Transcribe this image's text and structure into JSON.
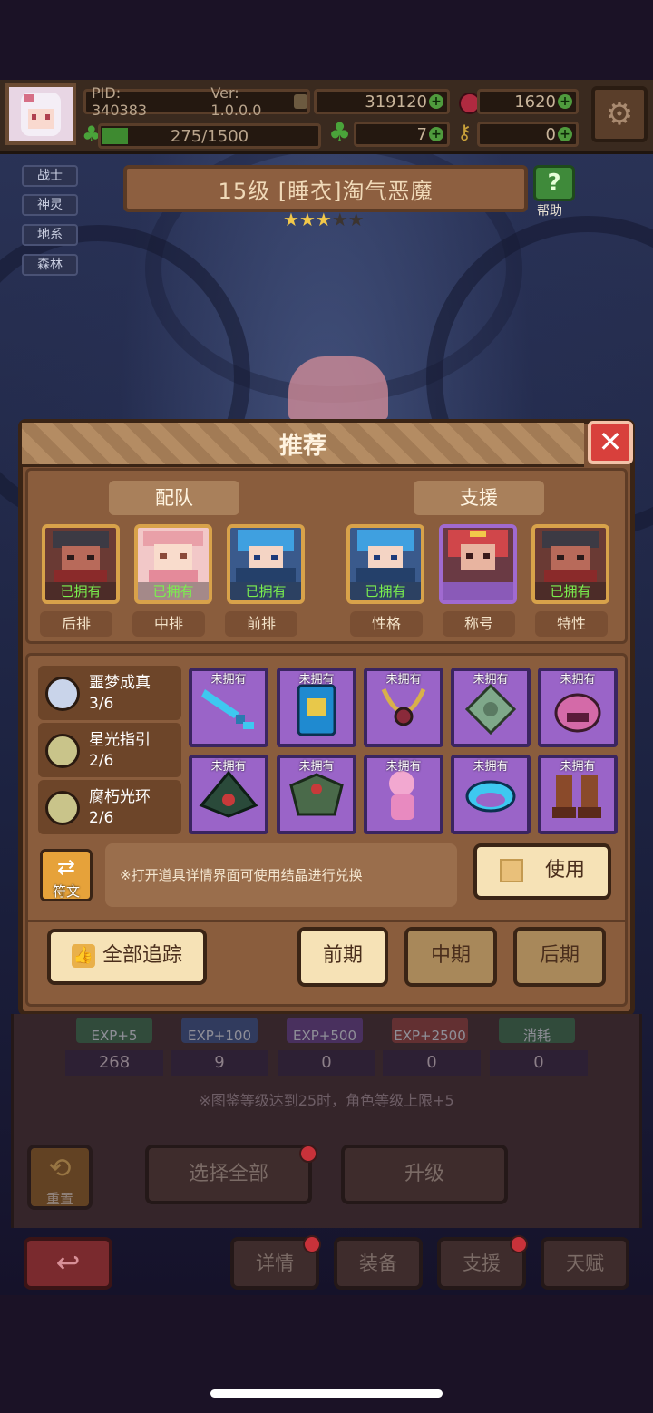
{
  "player": {
    "pid": "PID: 340383",
    "version": "Ver: 1.0.0.0",
    "gold": "319120",
    "gems": "1620",
    "exp": "275/1500",
    "clover": "7",
    "keys": "0"
  },
  "tags": [
    "战士",
    "神灵",
    "地系",
    "森林"
  ],
  "character": {
    "title": "15级 [睡衣]淘气恶魔",
    "stars_filled": 3,
    "stars_total": 5,
    "help_label": "帮助"
  },
  "modal": {
    "title": "推荐",
    "team_header": "配队",
    "support_header": "支援",
    "team": [
      {
        "status": "已拥有",
        "slot": "后排"
      },
      {
        "status": "已拥有",
        "slot": "中排"
      },
      {
        "status": "已拥有",
        "slot": "前排"
      }
    ],
    "support": [
      {
        "status": "已拥有",
        "slot": "性格"
      },
      {
        "status": "",
        "slot": "称号"
      },
      {
        "status": "已拥有",
        "slot": "特性"
      }
    ],
    "sets": [
      {
        "name": "噩梦成真",
        "count": "3/6",
        "color": "#c9d4ea"
      },
      {
        "name": "星光指引",
        "count": "2/6",
        "color": "#c9c48a"
      },
      {
        "name": "腐朽光环",
        "count": "2/6",
        "color": "#c9c48a"
      }
    ],
    "items_label": "未拥有",
    "rune_label": "符文",
    "hint": "※打开道具详情界面可使用结晶进行兑换",
    "use_label": "使用",
    "track_all_label": "全部追踪",
    "phase_early": "前期",
    "phase_mid": "中期",
    "phase_late": "后期"
  },
  "exp_items": [
    {
      "label": "EXP+5",
      "count": "268"
    },
    {
      "label": "EXP+100",
      "count": "9"
    },
    {
      "label": "EXP+500",
      "count": "0"
    },
    {
      "label": "EXP+2500",
      "count": "0"
    },
    {
      "label": "消耗",
      "count": "0"
    }
  ],
  "level_note": "※图鉴等级达到25时，角色等级上限+5",
  "bottom": {
    "reset_label": "重置",
    "select_all_label": "选择全部",
    "upgrade_label": "升级",
    "tabs": [
      "详情",
      "装备",
      "支援",
      "天赋"
    ]
  },
  "colors": {
    "owned_text": "#7bf04e",
    "item_bg": "#9a64c8",
    "close_red": "#d8403c"
  }
}
